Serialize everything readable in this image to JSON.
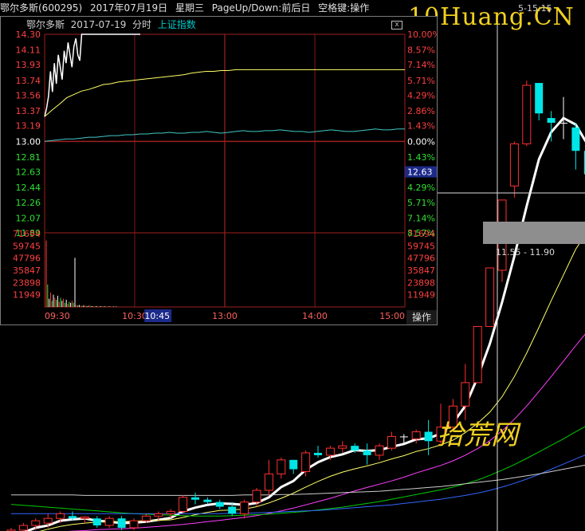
{
  "header": {
    "stock": "鄂尔多斯(600295)",
    "date": "2017年07月19日",
    "weekday": "星期三",
    "hint": "PageUp/Down:前后日",
    "hint2": "空格键:操作"
  },
  "watermark": {
    "site": "10Huang.CN",
    "cn": "拾荒网",
    "small": "5-15:15"
  },
  "kline": {
    "crosshair_price_range": "11.55 - 11.90",
    "colors": {
      "up": "#ff3030",
      "down": "#00e6e6",
      "flat": "#ffffff",
      "ma5": "#ffffff",
      "ma10": "#ffff66",
      "ma20": "#ff40ff",
      "ma30": "#00cc00",
      "ma60": "#3366ff",
      "ma120": "#cccccc"
    }
  },
  "popup": {
    "stock": "鄂尔多斯",
    "date": "2017-07-19",
    "mode": "分时",
    "index": "上证指数",
    "close_icon": "x-icon",
    "operate_label": "操作",
    "price_labels": [
      "14.30",
      "14.11",
      "13.93",
      "13.74",
      "13.56",
      "13.37",
      "13.19",
      "13.00",
      "12.81",
      "12.63",
      "12.44",
      "12.26",
      "12.07",
      "11.89"
    ],
    "pct_labels": [
      "10.00%",
      "8.57%",
      "7.14%",
      "5.71%",
      "4.29%",
      "2.86%",
      "1.43%",
      "0.00%",
      "1.43%",
      "2.86%",
      "4.29%",
      "5.71%",
      "7.14%",
      "8.57%"
    ],
    "current_price": "12.63",
    "volume_labels": [
      "71694",
      "59745",
      "47796",
      "35847",
      "23898",
      "11949"
    ],
    "time_labels": [
      "09:30",
      "10:30",
      "10:45",
      "13:00",
      "14:00",
      "15:00"
    ],
    "colors": {
      "up": "#ff4040",
      "down": "#30e030",
      "flat": "#ffffff",
      "price": "#ffffff",
      "avg": "#ffff66",
      "index": "#40c8c8"
    }
  },
  "chart_data": {
    "type": "candlestick",
    "title": "鄂尔多斯(600295)",
    "note": "Daily candles, price values estimated; last day 2017-07-19 (crosshair).",
    "candles": [
      {
        "o": 9.55,
        "h": 9.75,
        "l": 9.4,
        "c": 9.7
      },
      {
        "o": 9.7,
        "h": 9.85,
        "l": 9.55,
        "c": 9.8
      },
      {
        "o": 9.8,
        "h": 9.95,
        "l": 9.7,
        "c": 9.9
      },
      {
        "o": 9.85,
        "h": 10.05,
        "l": 9.75,
        "c": 9.95
      },
      {
        "o": 9.95,
        "h": 10.1,
        "l": 9.85,
        "c": 10.05
      },
      {
        "o": 10.0,
        "h": 10.1,
        "l": 9.9,
        "c": 9.95
      },
      {
        "o": 9.95,
        "h": 10.0,
        "l": 9.85,
        "c": 9.98
      },
      {
        "o": 9.95,
        "h": 10.0,
        "l": 9.75,
        "c": 9.8
      },
      {
        "o": 9.8,
        "h": 10.0,
        "l": 9.75,
        "c": 9.95
      },
      {
        "o": 9.95,
        "h": 10.0,
        "l": 9.7,
        "c": 9.75
      },
      {
        "o": 9.75,
        "h": 9.95,
        "l": 9.7,
        "c": 9.9
      },
      {
        "o": 9.9,
        "h": 10.05,
        "l": 9.85,
        "c": 10.0
      },
      {
        "o": 10.0,
        "h": 10.1,
        "l": 9.9,
        "c": 10.05
      },
      {
        "o": 10.05,
        "h": 10.15,
        "l": 9.95,
        "c": 10.1
      },
      {
        "o": 10.1,
        "h": 10.45,
        "l": 10.05,
        "c": 10.4
      },
      {
        "o": 10.4,
        "h": 10.5,
        "l": 10.25,
        "c": 10.35
      },
      {
        "o": 10.35,
        "h": 10.4,
        "l": 10.25,
        "c": 10.3
      },
      {
        "o": 10.3,
        "h": 10.35,
        "l": 10.15,
        "c": 10.2
      },
      {
        "o": 10.2,
        "h": 10.3,
        "l": 10.0,
        "c": 10.05
      },
      {
        "o": 10.05,
        "h": 10.35,
        "l": 9.95,
        "c": 10.3
      },
      {
        "o": 10.3,
        "h": 10.6,
        "l": 10.2,
        "c": 10.55
      },
      {
        "o": 10.55,
        "h": 11.2,
        "l": 10.45,
        "c": 10.9
      },
      {
        "o": 10.9,
        "h": 11.25,
        "l": 10.8,
        "c": 11.2
      },
      {
        "o": 11.2,
        "h": 11.05,
        "l": 10.9,
        "c": 11.0
      },
      {
        "o": 10.95,
        "h": 11.4,
        "l": 10.85,
        "c": 11.35
      },
      {
        "o": 11.35,
        "h": 11.5,
        "l": 11.25,
        "c": 11.3
      },
      {
        "o": 11.3,
        "h": 11.5,
        "l": 11.2,
        "c": 11.45
      },
      {
        "o": 11.45,
        "h": 11.6,
        "l": 11.35,
        "c": 11.5
      },
      {
        "o": 11.5,
        "h": 11.55,
        "l": 11.35,
        "c": 11.4
      },
      {
        "o": 11.4,
        "h": 11.55,
        "l": 11.1,
        "c": 11.3
      },
      {
        "o": 11.3,
        "h": 11.55,
        "l": 11.2,
        "c": 11.5
      },
      {
        "o": 11.45,
        "h": 11.8,
        "l": 11.4,
        "c": 11.7
      },
      {
        "o": 11.7,
        "h": 11.75,
        "l": 11.55,
        "c": 11.7
      },
      {
        "o": 11.65,
        "h": 11.85,
        "l": 11.55,
        "c": 11.8
      },
      {
        "o": 11.8,
        "h": 12.05,
        "l": 11.3,
        "c": 11.6
      },
      {
        "o": 11.6,
        "h": 12.4,
        "l": 11.55,
        "c": 11.9
      },
      {
        "o": 11.9,
        "h": 12.5,
        "l": 11.85,
        "c": 12.35
      },
      {
        "o": 12.35,
        "h": 13.25,
        "l": 12.05,
        "c": 12.85
      },
      {
        "o": 12.85,
        "h": 14.05,
        "l": 12.85,
        "c": 14.05
      },
      {
        "o": 14.05,
        "h": 15.3,
        "l": 14.05,
        "c": 15.3
      },
      {
        "o": 15.25,
        "h": 16.75,
        "l": 15.0,
        "c": 16.75
      },
      {
        "o": 17.05,
        "h": 18.0,
        "l": 16.8,
        "c": 17.95
      },
      {
        "o": 17.95,
        "h": 19.3,
        "l": 17.9,
        "c": 19.2
      },
      {
        "o": 19.25,
        "h": 19.15,
        "l": 18.45,
        "c": 18.6
      },
      {
        "o": 18.5,
        "h": 18.65,
        "l": 18.0,
        "c": 18.4
      },
      {
        "o": 18.4,
        "h": 18.95,
        "l": 18.05,
        "c": 18.4
      },
      {
        "o": 18.3,
        "h": 18.4,
        "l": 17.4,
        "c": 17.8
      },
      {
        "o": 17.8,
        "h": 17.85,
        "l": 16.9,
        "c": 17.3
      }
    ],
    "ma_series": [
      {
        "key": "ma5",
        "values": [
          9.55,
          9.65,
          9.75,
          9.8,
          9.9,
          9.93,
          9.95,
          9.9,
          9.88,
          9.85,
          9.86,
          9.88,
          9.92,
          9.96,
          10.1,
          10.18,
          10.24,
          10.27,
          10.26,
          10.24,
          10.28,
          10.4,
          10.62,
          10.75,
          10.99,
          11.15,
          11.26,
          11.32,
          11.41,
          11.39,
          11.41,
          11.48,
          11.54,
          11.64,
          11.66,
          11.76,
          11.99,
          12.35,
          12.96,
          13.68,
          14.57,
          15.55,
          16.62,
          17.62,
          18.2,
          18.5,
          18.36,
          17.92
        ]
      },
      {
        "key": "ma10",
        "values": [
          9.55,
          9.6,
          9.65,
          9.72,
          9.78,
          9.82,
          9.85,
          9.87,
          9.88,
          9.88,
          9.89,
          9.9,
          9.91,
          9.92,
          9.97,
          10.03,
          10.08,
          10.12,
          10.13,
          10.15,
          10.2,
          10.28,
          10.38,
          10.49,
          10.62,
          10.74,
          10.85,
          10.94,
          11.01,
          11.07,
          11.14,
          11.22,
          11.29,
          11.38,
          11.44,
          11.52,
          11.62,
          11.78,
          11.98,
          12.22,
          12.55,
          12.98,
          13.48,
          14.03,
          14.6,
          15.15,
          15.7,
          16.1
        ]
      },
      {
        "key": "ma20",
        "values": [
          9.6,
          9.61,
          9.63,
          9.64,
          9.66,
          9.68,
          9.69,
          9.71,
          9.72,
          9.73,
          9.74,
          9.76,
          9.78,
          9.8,
          9.82,
          9.85,
          9.88,
          9.91,
          9.94,
          9.97,
          10.01,
          10.06,
          10.11,
          10.17,
          10.24,
          10.31,
          10.38,
          10.46,
          10.54,
          10.61,
          10.68,
          10.75,
          10.83,
          10.92,
          11.0,
          11.08,
          11.18,
          11.3,
          11.44,
          11.61,
          11.82,
          12.07,
          12.35,
          12.66,
          12.98,
          13.31,
          13.64,
          13.96
        ]
      },
      {
        "key": "ma30",
        "values": [
          10.25,
          10.23,
          10.21,
          10.19,
          10.17,
          10.15,
          10.13,
          10.11,
          10.09,
          10.07,
          10.05,
          10.04,
          10.03,
          10.02,
          10.01,
          10.0,
          10.0,
          10.0,
          10.01,
          10.02,
          10.03,
          10.04,
          10.06,
          10.08,
          10.1,
          10.13,
          10.16,
          10.19,
          10.23,
          10.27,
          10.31,
          10.36,
          10.41,
          10.46,
          10.51,
          10.56,
          10.62,
          10.69,
          10.77,
          10.87,
          10.98,
          11.1,
          11.23,
          11.37,
          11.51,
          11.65,
          11.8,
          11.95
        ]
      },
      {
        "key": "ma60",
        "values": [
          10.05,
          10.05,
          10.05,
          10.05,
          10.05,
          10.05,
          10.05,
          10.05,
          10.05,
          10.05,
          10.05,
          10.05,
          10.05,
          10.05,
          10.05,
          10.05,
          10.05,
          10.05,
          10.06,
          10.06,
          10.07,
          10.08,
          10.09,
          10.1,
          10.11,
          10.12,
          10.14,
          10.16,
          10.18,
          10.2,
          10.22,
          10.24,
          10.27,
          10.3,
          10.33,
          10.36,
          10.4,
          10.44,
          10.49,
          10.55,
          10.62,
          10.7,
          10.79,
          10.89,
          11.0,
          11.11,
          11.22,
          11.33
        ]
      },
      {
        "key": "ma120",
        "values": [
          10.45,
          10.45,
          10.45,
          10.45,
          10.45,
          10.45,
          10.44,
          10.44,
          10.44,
          10.44,
          10.44,
          10.44,
          10.44,
          10.44,
          10.44,
          10.44,
          10.44,
          10.44,
          10.44,
          10.45,
          10.45,
          10.45,
          10.46,
          10.46,
          10.47,
          10.48,
          10.49,
          10.5,
          10.51,
          10.52,
          10.53,
          10.55,
          10.57,
          10.59,
          10.61,
          10.63,
          10.66,
          10.69,
          10.72,
          10.75,
          10.78,
          10.82,
          10.86,
          10.9,
          10.95,
          11.0,
          11.05,
          11.1
        ]
      }
    ],
    "ylim": [
      9.0,
      20.0
    ],
    "crosshair_index": 40,
    "intraday": {
      "prev_close": 13.0,
      "ylim": [
        11.89,
        14.3
      ],
      "price": [
        13.3,
        13.4,
        13.55,
        13.85,
        13.6,
        13.95,
        13.7,
        14.05,
        13.9,
        13.75,
        14.1,
        13.95,
        14.2,
        14.05,
        13.9,
        14.15,
        14.25,
        14.05,
        13.98,
        14.3,
        14.3,
        14.3,
        14.3,
        14.3,
        14.3,
        14.3,
        14.3,
        14.3,
        14.3,
        14.3,
        14.3,
        14.3,
        14.3,
        14.3,
        14.3,
        14.3,
        14.3,
        14.3,
        14.3,
        14.3,
        14.3,
        14.3,
        14.3,
        14.3,
        14.3,
        14.3,
        14.3,
        14.3,
        14.3,
        14.3
      ],
      "avg": [
        13.3,
        13.38,
        13.45,
        13.53,
        13.57,
        13.61,
        13.63,
        13.66,
        13.69,
        13.7,
        13.72,
        13.73,
        13.74,
        13.75,
        13.76,
        13.77,
        13.78,
        13.79,
        13.8,
        13.81,
        13.83,
        13.84,
        13.85,
        13.85,
        13.86,
        13.86,
        13.87,
        13.87,
        13.87,
        13.87,
        13.87,
        13.87,
        13.87,
        13.87,
        13.87,
        13.87,
        13.87,
        13.87,
        13.87,
        13.87,
        13.87,
        13.87,
        13.87,
        13.87,
        13.87,
        13.87,
        13.87,
        13.87,
        13.87,
        13.87
      ],
      "index": [
        13.0,
        13.01,
        13.02,
        13.03,
        13.03,
        13.04,
        13.05,
        13.05,
        13.06,
        13.07,
        13.07,
        13.08,
        13.08,
        13.09,
        13.09,
        13.1,
        13.1,
        13.11,
        13.1,
        13.1,
        13.11,
        13.11,
        13.12,
        13.11,
        13.1,
        13.11,
        13.12,
        13.13,
        13.12,
        13.12,
        13.13,
        13.13,
        13.14,
        13.13,
        13.12,
        13.12,
        13.11,
        13.12,
        13.13,
        13.14,
        13.13,
        13.12,
        13.12,
        13.13,
        13.14,
        13.15,
        13.14,
        13.14,
        13.15,
        13.15
      ],
      "volume": [
        65000,
        22000,
        8000,
        14000,
        6000,
        12000,
        9000,
        7000,
        11000,
        5000,
        9000,
        6000,
        8000,
        4000,
        7000,
        3000,
        5000,
        4000,
        6000,
        4000,
        48000,
        2000,
        1500,
        2000,
        1200,
        1000,
        1500,
        1200,
        1000,
        900,
        1800,
        1000,
        800,
        700,
        600,
        900,
        700,
        600,
        800,
        500,
        700,
        600,
        500,
        400,
        600,
        500,
        400,
        500,
        600,
        700
      ],
      "volume_ylim": [
        0,
        71694
      ]
    }
  }
}
